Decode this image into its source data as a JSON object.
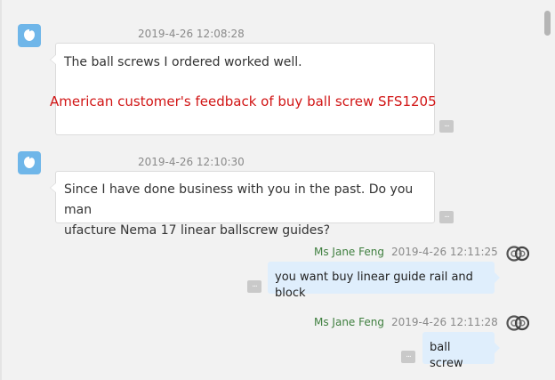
{
  "messages": [
    {
      "direction": "incoming",
      "timestamp": "2019-4-26 12:08:28",
      "text": "The ball screws I ordered worked well.",
      "annotation": "American customer's feedback of buy ball screw SFS1205"
    },
    {
      "direction": "incoming",
      "timestamp": "2019-4-26 12:10:30",
      "text_line1": "Since I have done business with you in the past. Do you man",
      "text_line2": "ufacture Nema 17 linear ballscrew guides?"
    },
    {
      "direction": "outgoing",
      "sender": "Ms Jane Feng",
      "timestamp": "2019-4-26 12:11:25",
      "text": "you want buy linear guide rail and block"
    },
    {
      "direction": "outgoing",
      "sender": "Ms Jane Feng",
      "timestamp": "2019-4-26 12:11:28",
      "text": "ball screw"
    }
  ],
  "more_label": "...",
  "colors": {
    "background": "#f2f2f2",
    "incoming_bubble": "#ffffff",
    "outgoing_bubble": "#dfeefc",
    "sender_name": "#3f7f3f",
    "annotation": "#d11515",
    "avatar": "#6fb6e9"
  },
  "icons": {
    "incoming_avatar": "user-avatar-icon",
    "outgoing_avatar": "bearing-avatar-icon",
    "more": "more-options-icon"
  }
}
